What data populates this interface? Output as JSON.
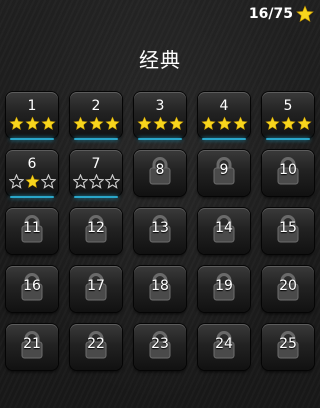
{
  "header": {
    "star_count": "16/75",
    "title": "经典"
  },
  "colors": {
    "star": "#f7d51d",
    "accent": "#2aa6c9"
  },
  "levels": [
    {
      "number": "1",
      "unlocked": true,
      "stars": 3
    },
    {
      "number": "2",
      "unlocked": true,
      "stars": 3
    },
    {
      "number": "3",
      "unlocked": true,
      "stars": 3
    },
    {
      "number": "4",
      "unlocked": true,
      "stars": 3
    },
    {
      "number": "5",
      "unlocked": true,
      "stars": 3
    },
    {
      "number": "6",
      "unlocked": true,
      "stars": 1
    },
    {
      "number": "7",
      "unlocked": true,
      "stars": 0
    },
    {
      "number": "8",
      "unlocked": false,
      "stars": 0
    },
    {
      "number": "9",
      "unlocked": false,
      "stars": 0
    },
    {
      "number": "10",
      "unlocked": false,
      "stars": 0
    },
    {
      "number": "11",
      "unlocked": false,
      "stars": 0
    },
    {
      "number": "12",
      "unlocked": false,
      "stars": 0
    },
    {
      "number": "13",
      "unlocked": false,
      "stars": 0
    },
    {
      "number": "14",
      "unlocked": false,
      "stars": 0
    },
    {
      "number": "15",
      "unlocked": false,
      "stars": 0
    },
    {
      "number": "16",
      "unlocked": false,
      "stars": 0
    },
    {
      "number": "17",
      "unlocked": false,
      "stars": 0
    },
    {
      "number": "18",
      "unlocked": false,
      "stars": 0
    },
    {
      "number": "19",
      "unlocked": false,
      "stars": 0
    },
    {
      "number": "20",
      "unlocked": false,
      "stars": 0
    },
    {
      "number": "21",
      "unlocked": false,
      "stars": 0
    },
    {
      "number": "22",
      "unlocked": false,
      "stars": 0
    },
    {
      "number": "23",
      "unlocked": false,
      "stars": 0
    },
    {
      "number": "24",
      "unlocked": false,
      "stars": 0
    },
    {
      "number": "25",
      "unlocked": false,
      "stars": 0
    }
  ]
}
